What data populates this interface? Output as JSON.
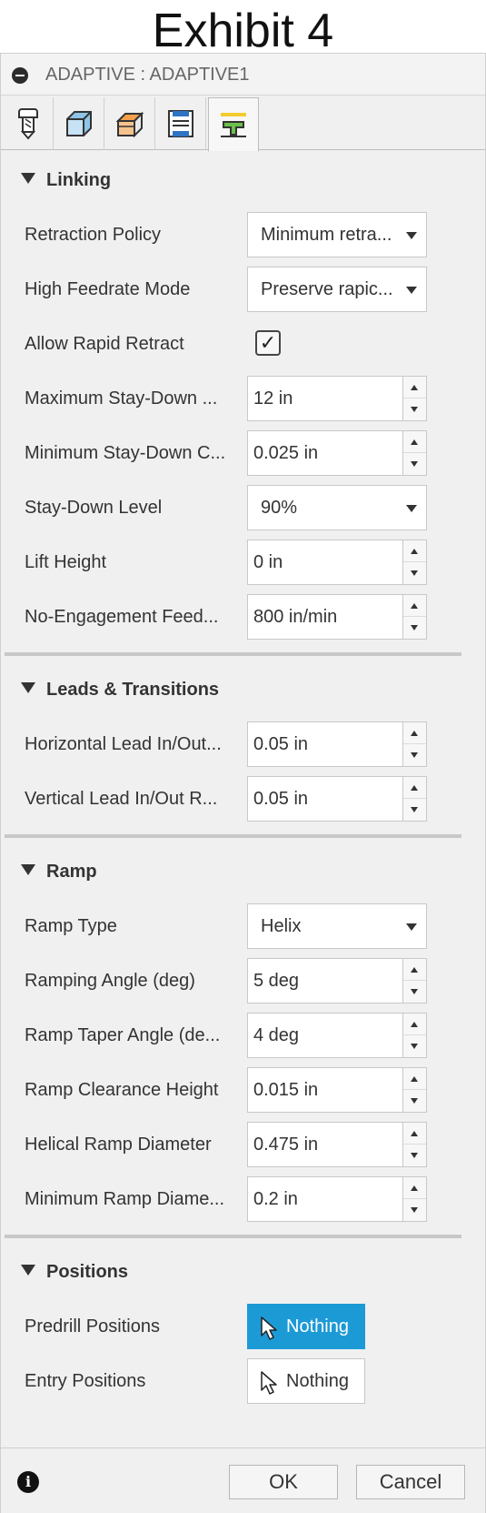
{
  "exhibit_title": "Exhibit 4",
  "dialog": {
    "title": "ADAPTIVE : ADAPTIVE1",
    "tabs": [
      {
        "icon": "tool-icon"
      },
      {
        "icon": "geometry-icon"
      },
      {
        "icon": "heights-icon"
      },
      {
        "icon": "passes-icon"
      },
      {
        "icon": "linking-icon",
        "active": true
      }
    ]
  },
  "linking": {
    "header": "Linking",
    "retraction_policy_label": "Retraction Policy",
    "retraction_policy_value": "Minimum retra...",
    "high_feedrate_label": "High Feedrate Mode",
    "high_feedrate_value": "Preserve rapic...",
    "allow_rapid_retract_label": "Allow Rapid Retract",
    "allow_rapid_retract_checked": "✓",
    "max_staydown_label": "Maximum Stay-Down ...",
    "max_staydown_value": "12 in",
    "min_staydown_label": "Minimum Stay-Down C...",
    "min_staydown_value": "0.025 in",
    "staydown_level_label": "Stay-Down Level",
    "staydown_level_value": "90%",
    "lift_height_label": "Lift Height",
    "lift_height_value": "0 in",
    "no_engagement_label": "No-Engagement Feed...",
    "no_engagement_value": "800 in/min"
  },
  "leads": {
    "header": "Leads & Transitions",
    "horizontal_label": "Horizontal Lead In/Out...",
    "horizontal_value": "0.05 in",
    "vertical_label": "Vertical Lead In/Out R...",
    "vertical_value": "0.05 in"
  },
  "ramp": {
    "header": "Ramp",
    "type_label": "Ramp Type",
    "type_value": "Helix",
    "angle_label": "Ramping Angle (deg)",
    "angle_value": "5 deg",
    "taper_label": "Ramp Taper Angle (de...",
    "taper_value": "4 deg",
    "clearance_label": "Ramp Clearance Height",
    "clearance_value": "0.015 in",
    "helical_label": "Helical Ramp Diameter",
    "helical_value": "0.475 in",
    "min_diameter_label": "Minimum Ramp Diame...",
    "min_diameter_value": "0.2 in"
  },
  "positions": {
    "header": "Positions",
    "predrill_label": "Predrill Positions",
    "predrill_value": "Nothing",
    "entry_label": "Entry Positions",
    "entry_value": "Nothing"
  },
  "footer": {
    "info": "i",
    "ok_label": "OK",
    "cancel_label": "Cancel"
  },
  "colors": {
    "accent": "#1c9ad6",
    "panel": "#f0f0f0"
  }
}
